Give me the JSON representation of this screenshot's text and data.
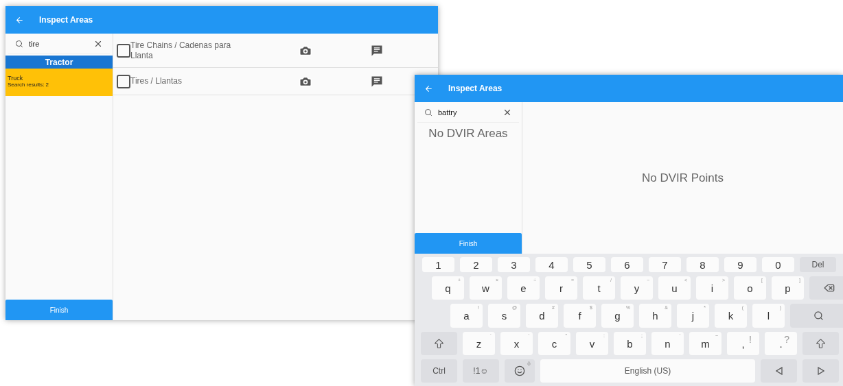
{
  "screens": [
    {
      "title": "Inspect Areas",
      "search": {
        "value": "tire"
      },
      "groups": [
        {
          "name": "Tractor",
          "areas": [
            {
              "name": "Truck",
              "detail": "Search results: 2",
              "selected": true
            }
          ]
        }
      ],
      "points": [
        {
          "label": "Tire Chains / Cadenas para Llanta",
          "checked": false
        },
        {
          "label": "Tires / Llantas",
          "checked": false
        }
      ],
      "finish": "Finish"
    },
    {
      "title": "Inspect Areas",
      "search": {
        "value": "battry"
      },
      "empty_areas": "No DVIR Areas",
      "empty_points": "No DVIR Points",
      "finish": "Finish",
      "keyboard": {
        "rows": [
          {
            "keys": [
              {
                "kind": "char",
                "label": "1"
              },
              {
                "kind": "char",
                "label": "2"
              },
              {
                "kind": "char",
                "label": "3"
              },
              {
                "kind": "char",
                "label": "4"
              },
              {
                "kind": "char",
                "label": "5"
              },
              {
                "kind": "char",
                "label": "6"
              },
              {
                "kind": "char",
                "label": "7"
              },
              {
                "kind": "char",
                "label": "8"
              },
              {
                "kind": "char",
                "label": "9"
              },
              {
                "kind": "char",
                "label": "0"
              },
              {
                "kind": "wide",
                "label": "Del"
              }
            ]
          },
          {
            "keys": [
              {
                "kind": "char",
                "label": "q",
                "alt": "+"
              },
              {
                "kind": "char",
                "label": "w",
                "alt": "×"
              },
              {
                "kind": "char",
                "label": "e",
                "alt": "÷"
              },
              {
                "kind": "char",
                "label": "r",
                "alt": "="
              },
              {
                "kind": "char",
                "label": "t",
                "alt": "/"
              },
              {
                "kind": "char",
                "label": "y",
                "alt": "−"
              },
              {
                "kind": "char",
                "label": "u",
                "alt": "<"
              },
              {
                "kind": "char",
                "label": "i",
                "alt": ">"
              },
              {
                "kind": "char",
                "label": "o",
                "alt": "["
              },
              {
                "kind": "char",
                "label": "p",
                "alt": "]"
              },
              {
                "kind": "backspace"
              }
            ]
          },
          {
            "keys": [
              {
                "kind": "char",
                "label": "a",
                "alt": "!"
              },
              {
                "kind": "char",
                "label": "s",
                "alt": "@"
              },
              {
                "kind": "char",
                "label": "d",
                "alt": "#"
              },
              {
                "kind": "char",
                "label": "f",
                "alt": "$"
              },
              {
                "kind": "char",
                "label": "g",
                "alt": "%"
              },
              {
                "kind": "char",
                "label": "h",
                "alt": "&"
              },
              {
                "kind": "char",
                "label": "j",
                "alt": "*"
              },
              {
                "kind": "char",
                "label": "k",
                "alt": "("
              },
              {
                "kind": "char",
                "label": "l",
                "alt": ")"
              },
              {
                "kind": "search"
              }
            ]
          },
          {
            "keys": [
              {
                "kind": "shift"
              },
              {
                "kind": "char",
                "label": "z",
                "alt": "`"
              },
              {
                "kind": "char",
                "label": "x",
                "alt": "'"
              },
              {
                "kind": "char",
                "label": "c",
                "alt": "\""
              },
              {
                "kind": "char",
                "label": "v",
                "alt": ":"
              },
              {
                "kind": "char",
                "label": "b",
                "alt": ";"
              },
              {
                "kind": "char",
                "label": "n",
                "alt": "'"
              },
              {
                "kind": "char",
                "label": "m",
                "alt": "~"
              },
              {
                "kind": "punct",
                "label": ",",
                "alt": "!"
              },
              {
                "kind": "punct",
                "label": ".",
                "alt": "?"
              },
              {
                "kind": "shift"
              }
            ]
          },
          {
            "keys": [
              {
                "kind": "wide",
                "label": "Ctrl"
              },
              {
                "kind": "wide",
                "label": "!1☺"
              },
              {
                "kind": "emoji"
              },
              {
                "kind": "space",
                "label": "English (US)"
              },
              {
                "kind": "left"
              },
              {
                "kind": "right"
              }
            ]
          }
        ]
      }
    }
  ]
}
